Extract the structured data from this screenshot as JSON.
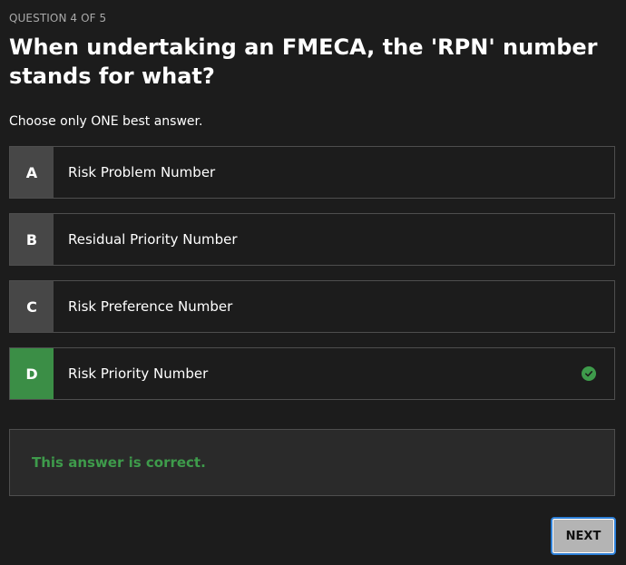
{
  "progress": "QUESTION 4 OF 5",
  "question": "When undertaking an FMECA, the 'RPN' number stands for what?",
  "instruction": "Choose only ONE best answer.",
  "options": [
    {
      "letter": "A",
      "label": "Risk Problem Number",
      "state": "default"
    },
    {
      "letter": "B",
      "label": "Residual Priority Number",
      "state": "default"
    },
    {
      "letter": "C",
      "label": "Risk Preference Number",
      "state": "default"
    },
    {
      "letter": "D",
      "label": "Risk Priority Number",
      "state": "correct",
      "icon": "check-circle-icon"
    }
  ],
  "feedback": "This answer is correct.",
  "next_label": "NEXT",
  "colors": {
    "background": "#1c1c1c",
    "correct": "#3e9b4b",
    "letter_box": "#474747",
    "focus_ring": "#2d7fd6"
  }
}
